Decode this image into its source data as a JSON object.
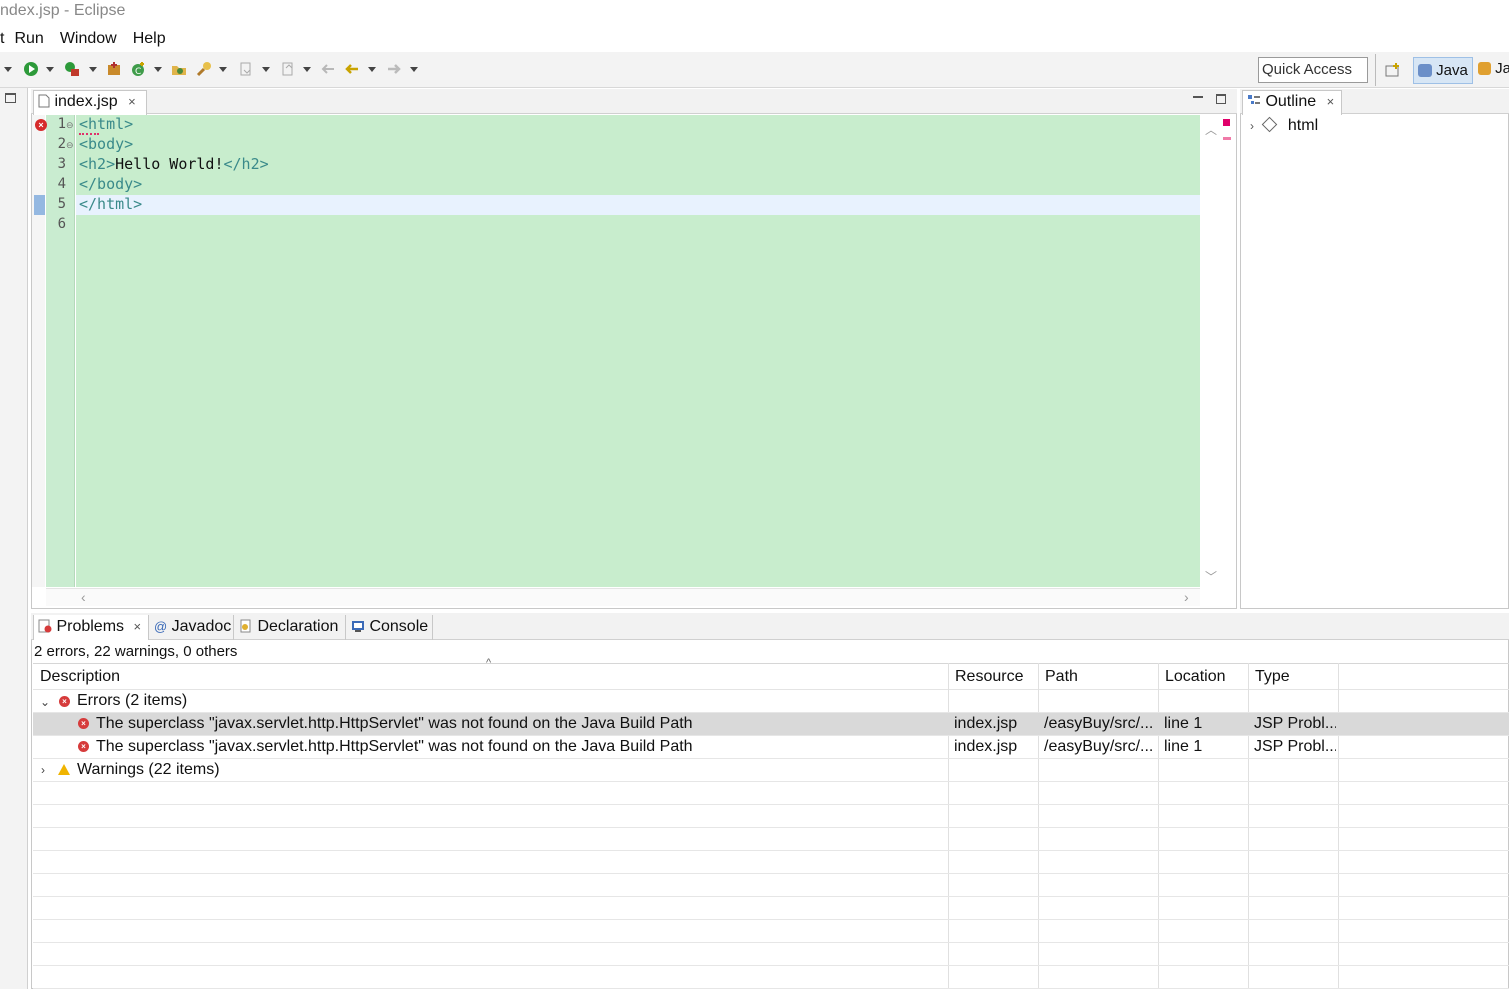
{
  "window": {
    "title": "ndex.jsp - Eclipse"
  },
  "menu": [
    "t",
    "Run",
    "Window",
    "Help"
  ],
  "toolbar": {
    "quick_access": "Quick Access",
    "perspective_active": "Java",
    "perspective_other": "Ja"
  },
  "editor": {
    "tab_label": "index.jsp",
    "line_numbers": [
      "1",
      "2",
      "3",
      "4",
      "5",
      "6"
    ],
    "lines": [
      {
        "parts": [
          [
            "tag",
            "<html>"
          ]
        ]
      },
      {
        "parts": [
          [
            "tag",
            "<body>"
          ]
        ]
      },
      {
        "parts": [
          [
            "tag",
            "<h2>"
          ],
          [
            "txt",
            "Hello World!"
          ],
          [
            "tag",
            "</h2>"
          ]
        ]
      },
      {
        "parts": [
          [
            "tag",
            "</body>"
          ]
        ]
      },
      {
        "parts": [
          [
            "tag",
            "</html>"
          ]
        ]
      },
      {
        "parts": []
      }
    ]
  },
  "outline": {
    "tab_label": "Outline",
    "items": [
      "html"
    ]
  },
  "bottom": {
    "tabs": [
      "Problems",
      "Javadoc",
      "Declaration",
      "Console"
    ],
    "summary": "2 errors, 22 warnings, 0 others",
    "columns": [
      "Description",
      "Resource",
      "Path",
      "Location",
      "Type"
    ],
    "groups": {
      "errors": "Errors (2 items)",
      "warnings": "Warnings (22 items)"
    },
    "rows": [
      {
        "description": "The superclass \"javax.servlet.http.HttpServlet\" was not found on the Java Build Path",
        "resource": "index.jsp",
        "path": "/easyBuy/src/...",
        "location": "line 1",
        "type": "JSP Probl..."
      },
      {
        "description": "The superclass \"javax.servlet.http.HttpServlet\" was not found on the Java Build Path",
        "resource": "index.jsp",
        "path": "/easyBuy/src/...",
        "location": "line 1",
        "type": "JSP Probl..."
      }
    ]
  },
  "colors": {
    "editor_bg": "#c8edcd",
    "current_line": "#e8f2fe",
    "tag": "#3a8a8a",
    "error": "#d62b2b",
    "warning": "#f0b400"
  }
}
